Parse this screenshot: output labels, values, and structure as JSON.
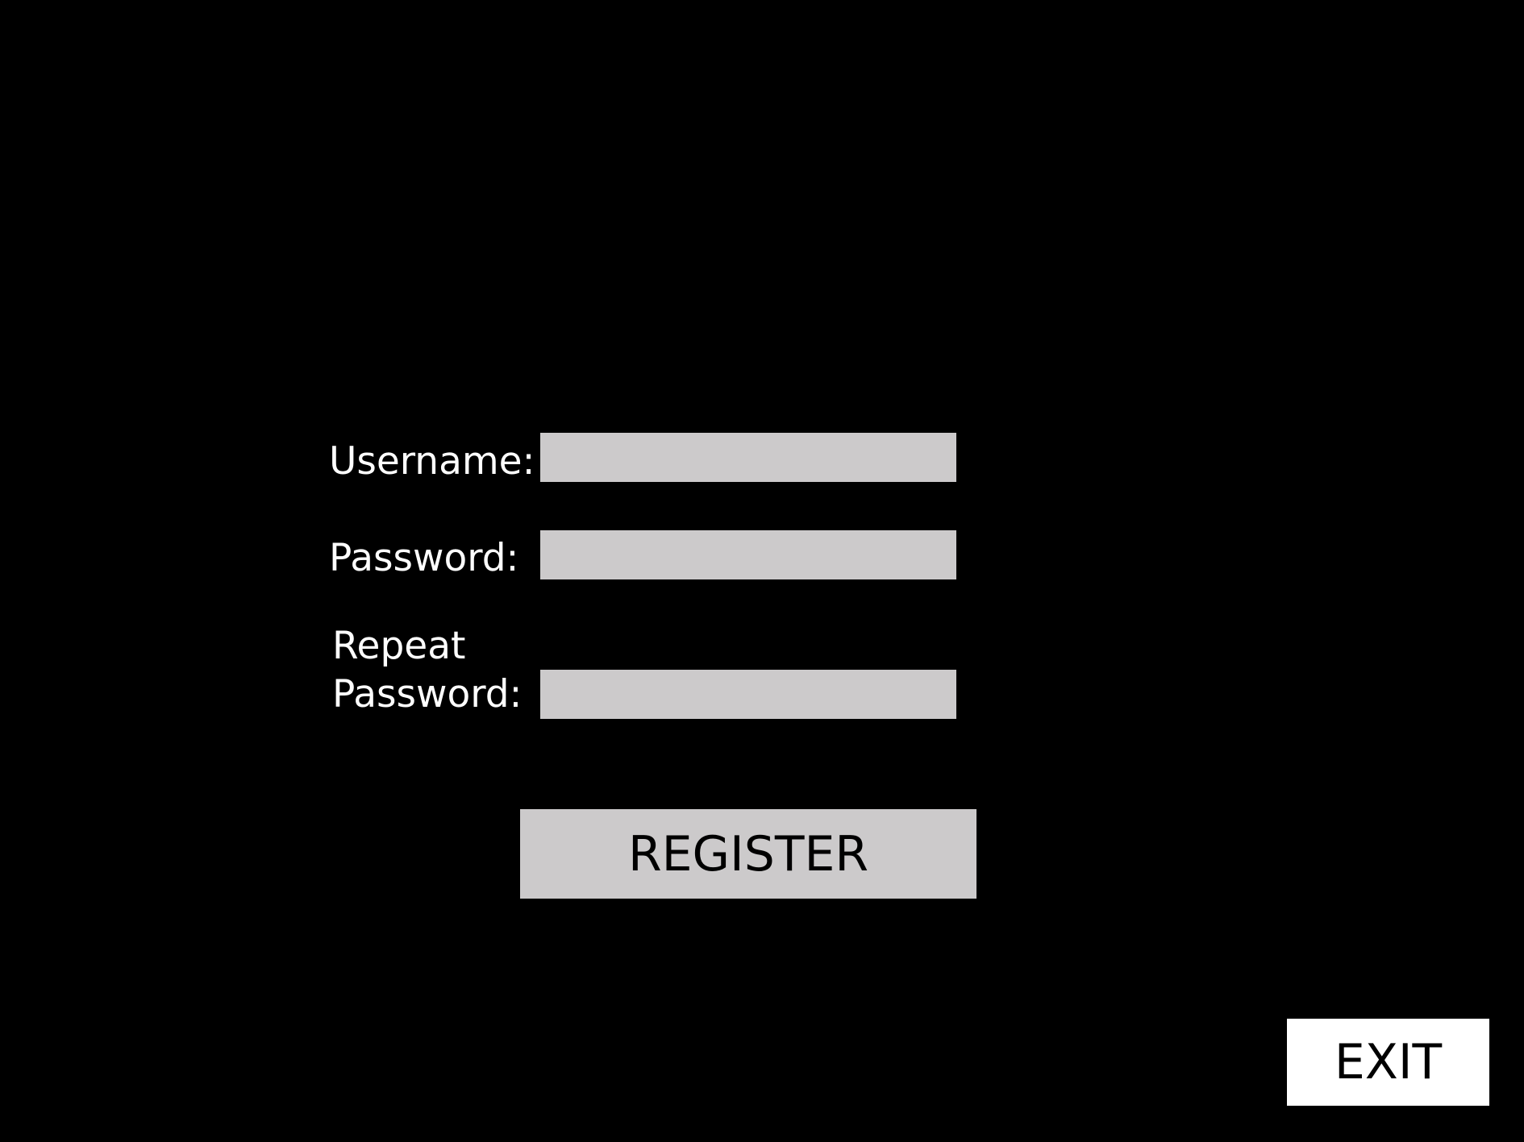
{
  "form": {
    "username_label": "Username:",
    "password_label": "Password:",
    "repeat_password_label_line1": "Repeat",
    "repeat_password_label_line2": "Password:",
    "username_value": "",
    "password_value": "",
    "repeat_password_value": "",
    "register_label": "REGISTER"
  },
  "exit_label": "EXIT",
  "colors": {
    "background": "#000000",
    "field": "#cccacb",
    "label_text": "#ffffff",
    "button_text": "#000000",
    "exit_background": "#ffffff"
  }
}
